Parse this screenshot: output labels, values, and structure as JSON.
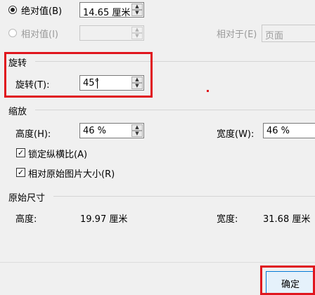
{
  "position": {
    "absolute_label": "绝对值(B)",
    "absolute_value": "14.65 厘米",
    "relative_label": "相对值(I)",
    "relative_to_label": "相对于(E)",
    "relative_to_value": "页面"
  },
  "rotation": {
    "section_title": "旋转",
    "rotate_label": "旋转(T):",
    "rotate_value": "45°"
  },
  "scale": {
    "section_title": "缩放",
    "height_label": "高度(H):",
    "height_value": "46 %",
    "width_label": "宽度(W):",
    "width_value": "46 %",
    "lock_aspect_label": "锁定纵横比(A)",
    "lock_aspect_checked": true,
    "relative_original_label": "相对原始图片大小(R)",
    "relative_original_checked": true
  },
  "original_size": {
    "section_title": "原始尺寸",
    "height_label": "高度:",
    "height_value": "19.97 厘米",
    "width_label": "宽度:",
    "width_value": "31.68 厘米"
  },
  "footer": {
    "ok_label": "确定"
  },
  "colors": {
    "highlight": "#e0161e",
    "dialog_bg": "#f0f0f0"
  }
}
